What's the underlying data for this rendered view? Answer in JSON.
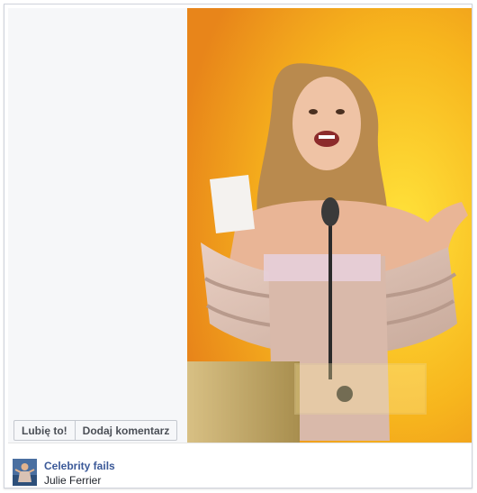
{
  "post": {
    "like_label": "Lubię to!",
    "comment_label": "Dodaj komentarz",
    "page_name": "Celebrity fails",
    "caption": "Julie Ferrier"
  },
  "photo": {
    "description_icon": "photo-woman-at-podium",
    "background_color": "#f1a21a"
  },
  "colors": {
    "link": "#3b5998",
    "panel": "#f6f7f9",
    "border": "#c4c8cf"
  }
}
